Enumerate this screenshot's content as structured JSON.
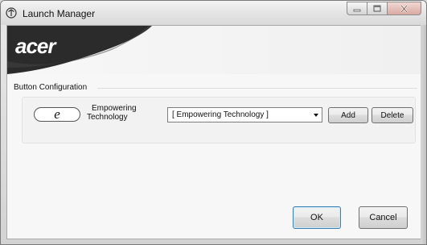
{
  "window": {
    "title": "Launch Manager",
    "caption_buttons": {
      "minimize_icon": "minimize-icon",
      "maximize_icon": "maximize-icon",
      "close_icon": "close-icon"
    }
  },
  "banner": {
    "logo_text": "acer",
    "color": "#2b2b2b"
  },
  "config": {
    "group_title": "Button Configuration",
    "button_glyph": "e",
    "button_label_line1": "Empowering",
    "button_label_line2": "Technology",
    "select_value": "[ Empowering Technology  ]",
    "add_label": "Add",
    "delete_label": "Delete"
  },
  "footer": {
    "ok_label": "OK",
    "cancel_label": "Cancel"
  }
}
